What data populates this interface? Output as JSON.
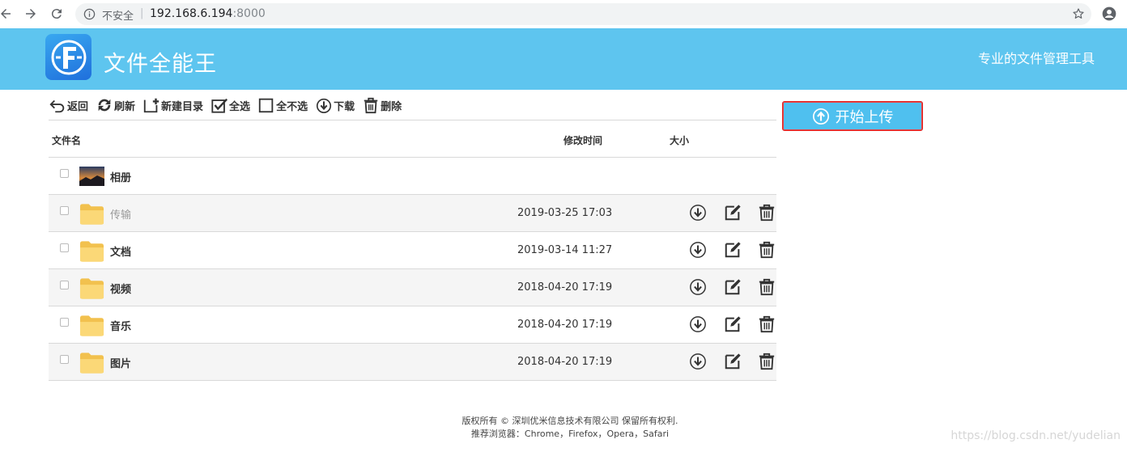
{
  "browser": {
    "insecure_label": "不安全",
    "separator": "|",
    "url_host": "192.168.6.194",
    "url_port": ":8000"
  },
  "header": {
    "logo_letter": "F",
    "title": "文件全能王",
    "slogan": "专业的文件管理工具"
  },
  "toolbar": {
    "back": "返回",
    "refresh": "刷新",
    "new_folder": "新建目录",
    "select_all": "全选",
    "select_none": "全不选",
    "download": "下载",
    "delete": "删除"
  },
  "upload": {
    "label": "开始上传"
  },
  "table": {
    "columns": {
      "name": "文件名",
      "modified": "修改时间",
      "size": "大小"
    },
    "rows": [
      {
        "name": "相册",
        "modified": "",
        "type": "album"
      },
      {
        "name": "传输",
        "modified": "2019-03-25 17:03",
        "type": "folder"
      },
      {
        "name": "文档",
        "modified": "2019-03-14 11:27",
        "type": "folder"
      },
      {
        "name": "视频",
        "modified": "2018-04-20 17:19",
        "type": "folder"
      },
      {
        "name": "音乐",
        "modified": "2018-04-20 17:19",
        "type": "folder"
      },
      {
        "name": "图片",
        "modified": "2018-04-20 17:19",
        "type": "folder"
      }
    ]
  },
  "footer": {
    "line1": "版权所有 © 深圳优米信息技术有限公司 保留所有权利.",
    "line2": "推荐浏览器：Chrome，Firefox，Opera，Safari"
  },
  "watermark": "https://blog.csdn.net/yudelian",
  "colors": {
    "banner": "#5ec5ef",
    "upload_button": "#4fc0ef",
    "highlight_outline": "#dd2222"
  }
}
